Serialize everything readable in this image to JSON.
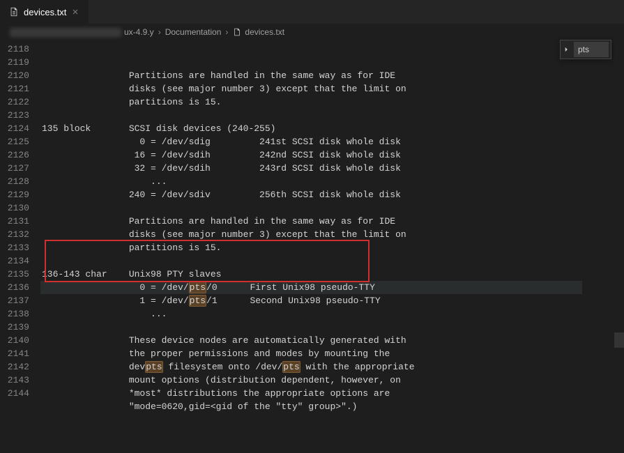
{
  "tab": {
    "filename": "devices.txt",
    "icon": "file-text-icon"
  },
  "breadcrumbs": {
    "seg1": "ux-4.9.y",
    "seg2": "Documentation",
    "seg3": "devices.txt"
  },
  "search": {
    "value": "pts"
  },
  "lines": [
    {
      "num": "2118",
      "text": "\t\tPartitions are handled in the same way as for IDE"
    },
    {
      "num": "2119",
      "text": "\t\tdisks (see major number 3) except that the limit on"
    },
    {
      "num": "2120",
      "text": "\t\tpartitions is 15."
    },
    {
      "num": "2121",
      "text": ""
    },
    {
      "num": "2122",
      "text": "135 block\tSCSI disk devices (240-255)"
    },
    {
      "num": "2123",
      "text": "\t\t  0 = /dev/sdig\t\t241st SCSI disk whole disk"
    },
    {
      "num": "2124",
      "text": "\t\t 16 = /dev/sdih\t\t242nd SCSI disk whole disk"
    },
    {
      "num": "2125",
      "text": "\t\t 32 = /dev/sdih\t\t243rd SCSI disk whole disk"
    },
    {
      "num": "2126",
      "text": "\t\t    ..."
    },
    {
      "num": "2127",
      "text": "\t\t240 = /dev/sdiv\t\t256th SCSI disk whole disk"
    },
    {
      "num": "2128",
      "text": ""
    },
    {
      "num": "2129",
      "text": "\t\tPartitions are handled in the same way as for IDE"
    },
    {
      "num": "2130",
      "text": "\t\tdisks (see major number 3) except that the limit on"
    },
    {
      "num": "2131",
      "text": "\t\tpartitions is 15."
    },
    {
      "num": "2132",
      "text": ""
    },
    {
      "num": "2133",
      "text": "136-143 char\tUnix98 PTY slaves"
    },
    {
      "num": "2134",
      "text": "\t\t  0 = /dev/{pts}/0\tFirst Unix98 pseudo-TTY",
      "current": true
    },
    {
      "num": "2135",
      "text": "\t\t  1 = /dev/{pts}/1\tSecond Unix98 pseudo-TTY"
    },
    {
      "num": "2136",
      "text": "\t\t    ..."
    },
    {
      "num": "2137",
      "text": ""
    },
    {
      "num": "2138",
      "text": "\t\tThese device nodes are automatically generated with"
    },
    {
      "num": "2139",
      "text": "\t\tthe proper permissions and modes by mounting the"
    },
    {
      "num": "2140",
      "text": "\t\tdev{pts} filesystem onto /dev/{pts} with the appropriate"
    },
    {
      "num": "2141",
      "text": "\t\tmount options (distribution dependent, however, on"
    },
    {
      "num": "2142",
      "text": "\t\t*most* distributions the appropriate options are"
    },
    {
      "num": "2143",
      "text": "\t\t\"mode=0620,gid=<gid of the \"tty\" group>\".)"
    },
    {
      "num": "2144",
      "text": ""
    }
  ]
}
